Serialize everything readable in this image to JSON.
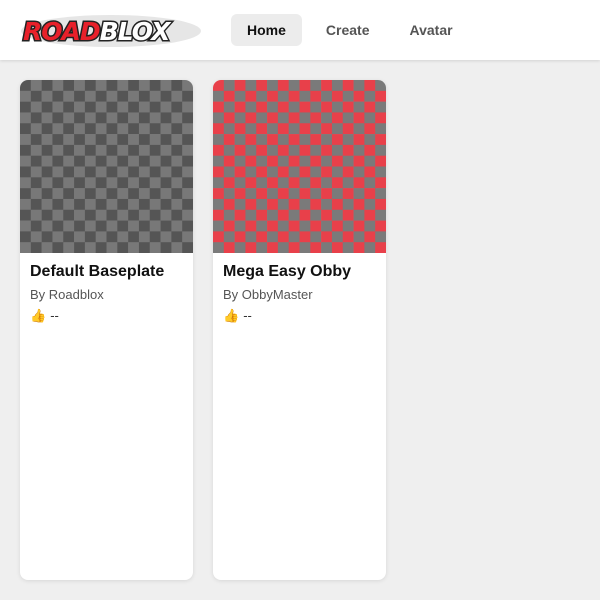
{
  "header": {
    "logo_text": "ROADBLOX",
    "nav": [
      {
        "label": "Home",
        "active": true
      },
      {
        "label": "Create",
        "active": false
      },
      {
        "label": "Avatar",
        "active": false
      }
    ]
  },
  "games": [
    {
      "title": "Default Baseplate",
      "author": "By Roadblox",
      "rating": "--",
      "thumb_colors": [
        "#555555",
        "#787878"
      ]
    },
    {
      "title": "Mega Easy Obby",
      "author": "By ObbyMaster",
      "rating": "--",
      "thumb_colors": [
        "#e8404a",
        "#7a7a7a"
      ]
    }
  ],
  "icons": {
    "rating": "thumbs-up-icon"
  },
  "colors": {
    "logo_red": "#e8202a",
    "logo_dark": "#222222",
    "background": "#efefef"
  }
}
